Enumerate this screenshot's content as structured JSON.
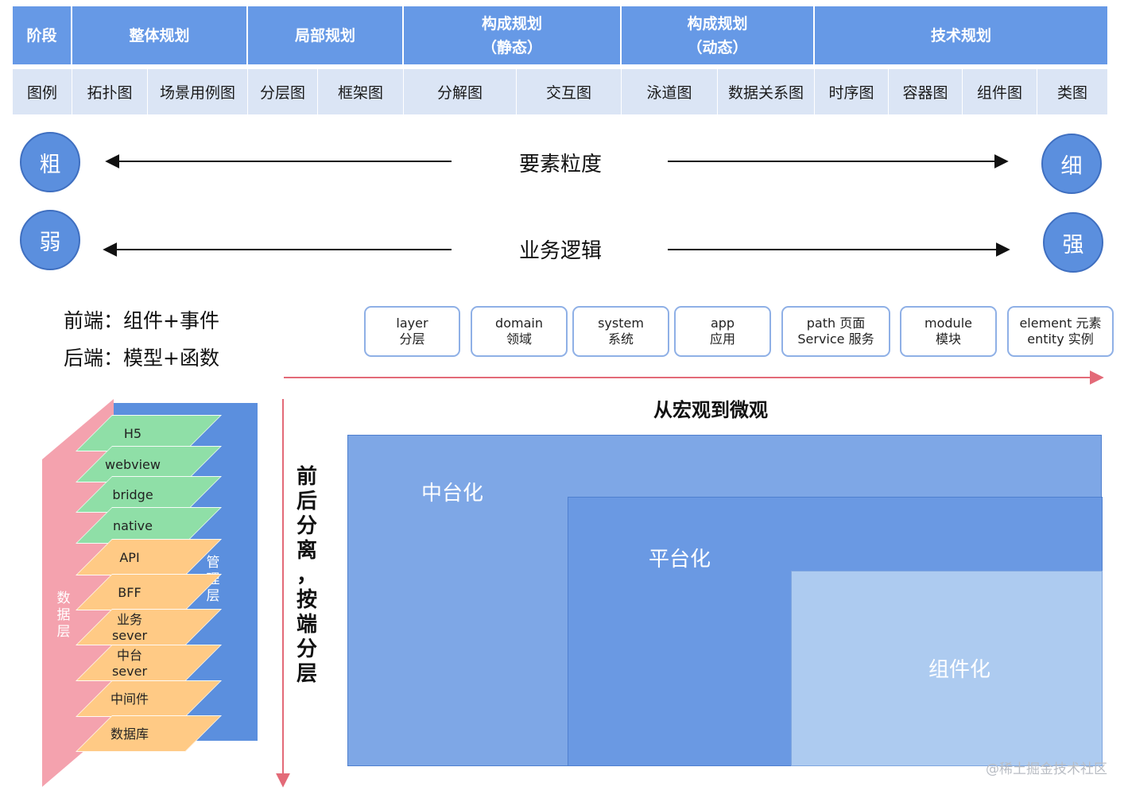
{
  "header": {
    "stage": "阶段",
    "groups": [
      {
        "line1": "整体规划",
        "line2": ""
      },
      {
        "line1": "局部规划",
        "line2": ""
      },
      {
        "line1": "构成规划",
        "line2": "（静态）"
      },
      {
        "line1": "构成规划",
        "line2": "（动态）"
      },
      {
        "line1": "技术规划",
        "line2": ""
      }
    ]
  },
  "diagrams": {
    "legend": "图例",
    "items": [
      "拓扑图",
      "场景用例图",
      "分层图",
      "框架图",
      "分解图",
      "交互图",
      "泳道图",
      "数据关系图",
      "时序图",
      "容器图",
      "组件图",
      "类图"
    ]
  },
  "scales": [
    {
      "left": "粗",
      "label": "要素粒度",
      "right": "细"
    },
    {
      "left": "弱",
      "label": "业务逻辑",
      "right": "强"
    }
  ],
  "notes": {
    "frontend": "前端：组件+事件",
    "backend": "后端：模型+函数"
  },
  "scopes": [
    {
      "en": "layer",
      "zh": "分层"
    },
    {
      "en": "domain",
      "zh": "领域"
    },
    {
      "en": "system",
      "zh": "系统"
    },
    {
      "en": "app",
      "zh": "应用"
    },
    {
      "en": "path 页面",
      "zh": "Service 服务"
    },
    {
      "en": "module",
      "zh": "模块"
    },
    {
      "en": "element 元素",
      "zh": "entity 实例"
    }
  ],
  "macro_label": "从宏观到微观",
  "vertical_title": [
    "前",
    "后",
    "分",
    "离",
    "，",
    "按",
    "端",
    "分",
    "层"
  ],
  "stack": {
    "data_layer": [
      "数",
      "据",
      "层"
    ],
    "mgmt_layer": [
      "管",
      "理",
      "层"
    ],
    "layers": [
      {
        "text1": "H5",
        "text2": "",
        "kind": "green"
      },
      {
        "text1": "webview",
        "text2": "",
        "kind": "green"
      },
      {
        "text1": "bridge",
        "text2": "",
        "kind": "green"
      },
      {
        "text1": "native",
        "text2": "",
        "kind": "green"
      },
      {
        "text1": "API",
        "text2": "",
        "kind": "orange"
      },
      {
        "text1": "BFF",
        "text2": "",
        "kind": "orange"
      },
      {
        "text1": "业务",
        "text2": "sever",
        "kind": "orange"
      },
      {
        "text1": "中台",
        "text2": "sever",
        "kind": "orange"
      },
      {
        "text1": "中间件",
        "text2": "",
        "kind": "orange"
      },
      {
        "text1": "数据库",
        "text2": "",
        "kind": "orange"
      }
    ]
  },
  "nested": {
    "outer": "中台化",
    "middle": "平台化",
    "inner": "组件化"
  },
  "colors": {
    "header": "#6699e6",
    "row": "#dbe5f5",
    "circle": "#5b8fde",
    "green": "#8fdfa7",
    "orange": "#ffca85",
    "pink": "#f4a2ae",
    "outer": "#7ea7e6",
    "middle": "#6a99e3",
    "inner": "#adcbf0",
    "red_arrow": "#e36a78"
  },
  "watermark": "@稀土掘金技术社区"
}
